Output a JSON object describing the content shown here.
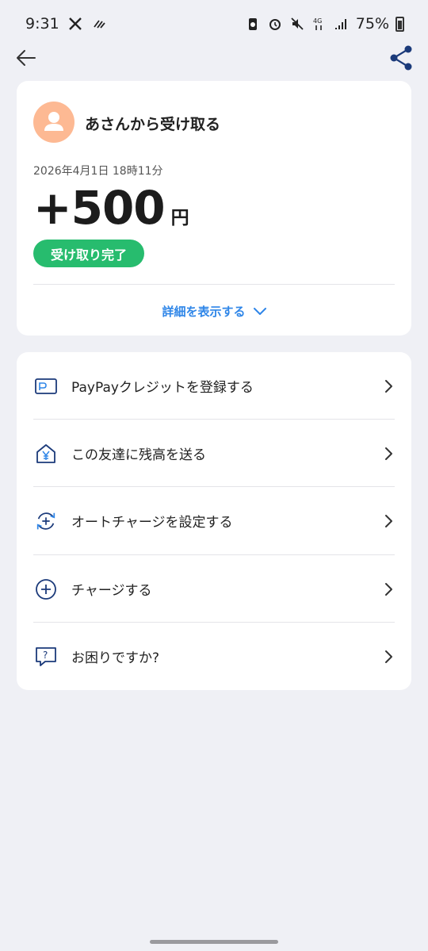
{
  "status_bar": {
    "time": "9:31",
    "battery": "75%"
  },
  "receipt": {
    "sender_title": "あさんから受け取る",
    "timestamp": "2026年4月1日 18時11分",
    "amount": "+500",
    "currency_unit": "円",
    "status": "受け取り完了",
    "details_toggle": "詳細を表示する"
  },
  "menu": {
    "items": [
      {
        "label": "PayPayクレジットを登録する",
        "icon": "card-icon"
      },
      {
        "label": "この友達に残高を送る",
        "icon": "house-yen-icon"
      },
      {
        "label": "オートチャージを設定する",
        "icon": "auto-charge-icon"
      },
      {
        "label": "チャージする",
        "icon": "plus-circle-icon"
      },
      {
        "label": "お困りですか?",
        "icon": "help-bubble-icon"
      }
    ]
  },
  "colors": {
    "accent_blue": "#2f86e8",
    "status_green": "#27bc6e",
    "icon_navy": "#1b3a7a",
    "avatar_peach": "#fdb993"
  }
}
